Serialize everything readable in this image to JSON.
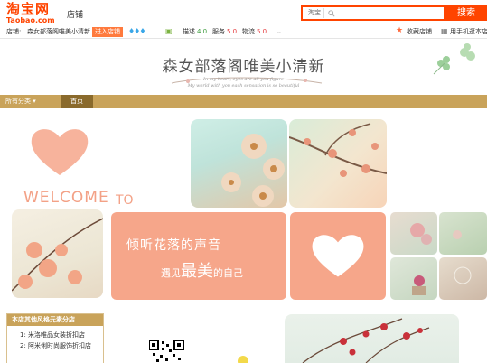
{
  "header": {
    "logo_cn": "淘宝网",
    "logo_en": "Taobao.com",
    "nav_shops": "店铺",
    "search_scope": "淘宝",
    "search_button": "搜索"
  },
  "shopbar": {
    "shop_label": "店铺:",
    "shop_name": "森女部落阁唯美小清新",
    "enter_shop": "进入店铺",
    "diamonds": "♦♦♦",
    "desc_label": "描述",
    "desc_value": "4.0",
    "service_label": "服务",
    "service_value": "5.0",
    "logistics_label": "物流",
    "logistics_value": "5.0",
    "favorite": "收藏店铺",
    "mobile": "用手机逛本店",
    "colors": {
      "good": "#3a9a3a",
      "high": "#e4393c"
    }
  },
  "banner": {
    "title": "森女部落阁唯美小清新",
    "sub1": "In my heart, eyes are all you figure",
    "sub2": "My world with you each sensation is so beautiful"
  },
  "nav": {
    "categories": "所有分类",
    "home": "首页"
  },
  "content": {
    "welcome": "WELCOME",
    "to": "TO",
    "slogan_line1": "倾听花落的声音",
    "slogan_line2_a": "遇见",
    "slogan_line2_b": "最美",
    "slogan_line2_c": "的自己",
    "accent_color": "#f6a68a"
  },
  "sidebar": {
    "title": "本店其他风格元素分店",
    "items": [
      "1: 米洛唯品女装折扣店",
      "2: 阿米俐时尚服饰折扣店"
    ]
  }
}
